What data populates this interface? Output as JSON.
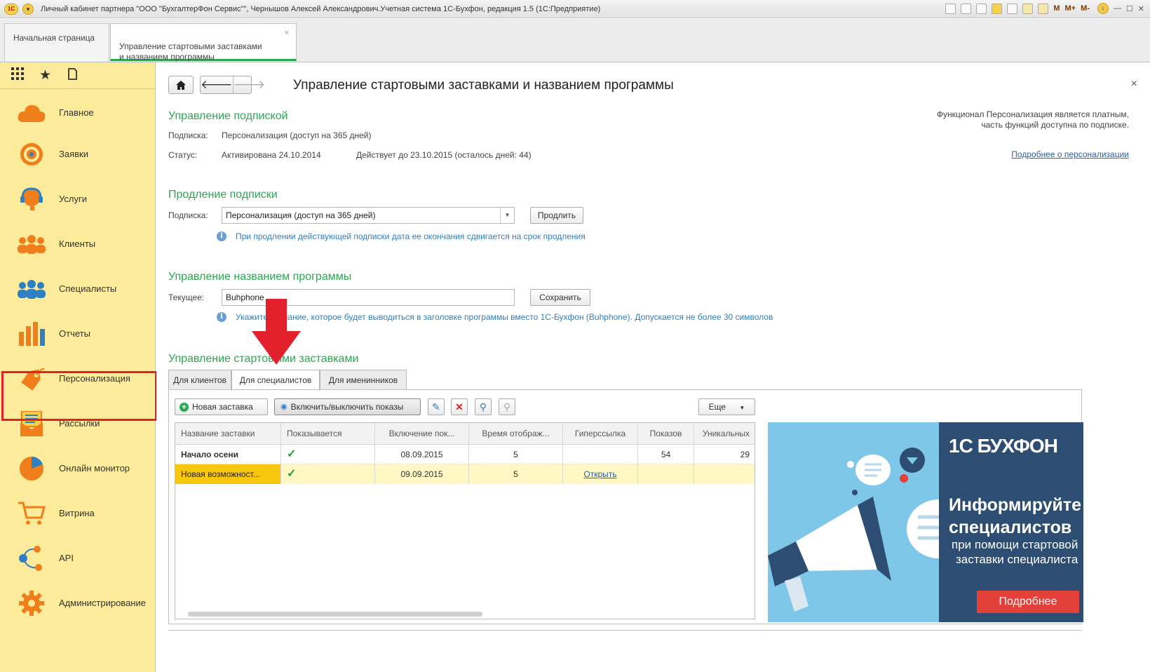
{
  "window": {
    "title": "Личный кабинет партнера \"ООО \"БухгалтерФон Сервис\"\", Чернышов Алексей Александрович.Учетная система 1С-Бухфон, редакция 1.5  (1С:Предприятие)",
    "toolbar_m": "M",
    "toolbar_mplus": "M+",
    "toolbar_mminus": "M-"
  },
  "tabs": [
    {
      "label": "Начальная страница"
    },
    {
      "label": "Управление стартовыми заставками\nи названием программы",
      "close": "×"
    }
  ],
  "sidebar": {
    "items": [
      {
        "label": "Главное",
        "icon": "cloud-icon"
      },
      {
        "label": "Заявки",
        "icon": "target-icon"
      },
      {
        "label": "Услуги",
        "icon": "headset-icon"
      },
      {
        "label": "Клиенты",
        "icon": "clients-icon"
      },
      {
        "label": "Специалисты",
        "icon": "specialists-icon"
      },
      {
        "label": "Отчеты",
        "icon": "bar-chart-icon"
      },
      {
        "label": "Персонализация",
        "icon": "tag-icon"
      },
      {
        "label": "Рассылки",
        "icon": "mail-icon"
      },
      {
        "label": "Онлайн монитор",
        "icon": "pie-chart-icon"
      },
      {
        "label": "Витрина",
        "icon": "cart-icon"
      },
      {
        "label": "API",
        "icon": "nodes-icon"
      },
      {
        "label": "Администрирование",
        "icon": "gear-icon"
      }
    ]
  },
  "page": {
    "title": "Управление стартовыми заставками и названием программы",
    "close": "×"
  },
  "subscription": {
    "heading": "Управление подпиской",
    "sub_label": "Подписка:",
    "sub_value": "Персонализация (доступ на 365 дней)",
    "status_label": "Статус:",
    "status_value": "Активирована 24.10.2014",
    "valid_until": "Действует до 23.10.2015 (осталось дней:  44)",
    "note": "Функционал Персонализация является платным,\nчасть функций доступна по подписке.",
    "more_link": "Подробнее о персонализации"
  },
  "renewal": {
    "heading": "Продление подписки",
    "label": "Подписка:",
    "value": "Персонализация (доступ на 365 дней)",
    "button": "Продлить",
    "hint": "При продлении действующей подписки дата ее окончания сдвигается на срок продления"
  },
  "program_name": {
    "heading": "Управление названием программы",
    "label": "Текущее:",
    "value": "Buhphone",
    "button": "Сохранить",
    "hint": "Укажите название, которое будет выводиться в заголовке программы вместо 1С-Бухфон (Buhphone). Допускается не более 30 символов"
  },
  "splash": {
    "heading": "Управление стартовыми заставками",
    "tabs": [
      "Для клиентов",
      "Для специалистов",
      "Для именинников"
    ],
    "new_button": "Новая заставка",
    "toggle_button": "Включить/выключить показы",
    "more_button": "Еще",
    "columns": [
      "Название заставки",
      "Показывается",
      "Включение пок...",
      "Время отображ...",
      "Гиперссылка",
      "Показов",
      "Уникальных"
    ],
    "rows": [
      {
        "name": "Начало осени",
        "shown": "✓",
        "enabled": "08.09.2015",
        "time": "5",
        "link": "",
        "views": "54",
        "unique": "29"
      },
      {
        "name": "Новая возможност...",
        "shown": "✓",
        "enabled": "09.09.2015",
        "time": "5",
        "link": "Открыть",
        "views": "",
        "unique": ""
      }
    ]
  },
  "promo": {
    "brand": "1С БУХФОН",
    "headline1": "Информируйте",
    "headline2": "специалистов",
    "sub1": "при помощи стартовой",
    "sub2": "заставки специалиста",
    "button": "Подробнее"
  },
  "colors": {
    "accent_green": "#2aa850",
    "sidebar_bg": "#fbeb9b",
    "highlight_red": "#e3212d",
    "selected_row": "#f6c70c"
  }
}
